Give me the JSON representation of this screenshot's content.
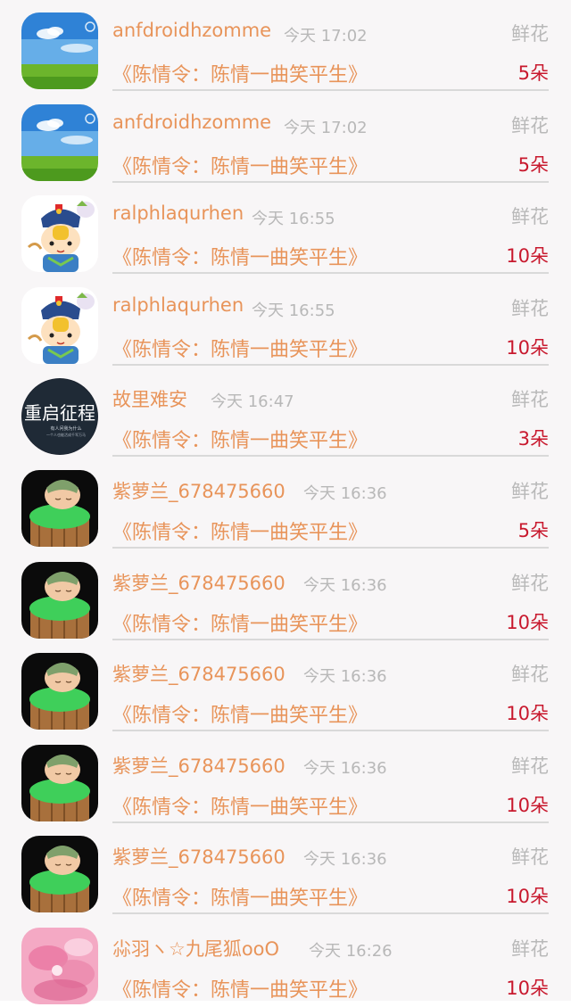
{
  "gift_list": {
    "gift_label": "鲜花",
    "book_title": "《陈情令：陈情一曲笑平生》",
    "items": [
      {
        "username": "anfdroidhzomme",
        "time": "今天 17:02",
        "quantity": "5朵",
        "avatar": "sky-grass-avatar"
      },
      {
        "username": "anfdroidhzomme",
        "time": "今天 17:02",
        "quantity": "5朵",
        "avatar": "sky-grass-avatar"
      },
      {
        "username": "ralphlaqurhen",
        "time": "今天 16:55",
        "quantity": "10朵",
        "avatar": "cartoon-official-avatar"
      },
      {
        "username": "ralphlaqurhen",
        "time": "今天 16:55",
        "quantity": "10朵",
        "avatar": "cartoon-official-avatar"
      },
      {
        "username": "故里难安",
        "time": "今天 16:47",
        "quantity": "3朵",
        "avatar": "calligraphy-avatar"
      },
      {
        "username": "紫萝兰_678475660",
        "time": "今天 16:36",
        "quantity": "5朵",
        "avatar": "sleeping-baby-avatar"
      },
      {
        "username": "紫萝兰_678475660",
        "time": "今天 16:36",
        "quantity": "10朵",
        "avatar": "sleeping-baby-avatar"
      },
      {
        "username": "紫萝兰_678475660",
        "time": "今天 16:36",
        "quantity": "10朵",
        "avatar": "sleeping-baby-avatar"
      },
      {
        "username": "紫萝兰_678475660",
        "time": "今天 16:36",
        "quantity": "10朵",
        "avatar": "sleeping-baby-avatar"
      },
      {
        "username": "紫萝兰_678475660",
        "time": "今天 16:36",
        "quantity": "10朵",
        "avatar": "sleeping-baby-avatar"
      },
      {
        "username": "尛羽ヽ☆九尾狐ooO",
        "time": "今天 16:26",
        "quantity": "10朵",
        "avatar": "pink-flower-avatar"
      }
    ],
    "avatar_text": {
      "calligraphy_main": "重启征程",
      "calligraphy_small_1": "有人问我为什么",
      "calligraphy_small_2": "一个人也能活成千军万马"
    }
  },
  "colors": {
    "username": "#e8945a",
    "book": "#e8945a",
    "time": "#b8b8b8",
    "gift_label": "#b9b9b9",
    "quantity": "#c8192e",
    "divider": "#d9d9d9",
    "background": "#f8f6f7"
  }
}
